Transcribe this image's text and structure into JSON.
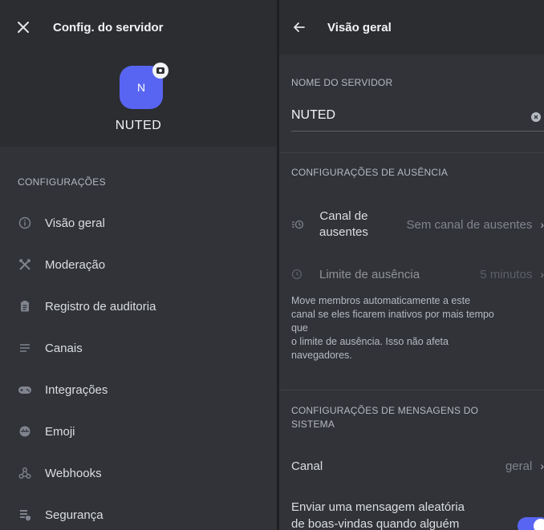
{
  "left": {
    "title": "Config. do servidor",
    "server_initial": "N",
    "server_name": "NUTED",
    "section_label": "CONFIGURAÇÕES",
    "menu": [
      {
        "label": "Visão geral",
        "icon": "info-icon"
      },
      {
        "label": "Moderação",
        "icon": "swords-icon"
      },
      {
        "label": "Registro de auditoria",
        "icon": "clipboard-icon"
      },
      {
        "label": "Canais",
        "icon": "list-icon"
      },
      {
        "label": "Integrações",
        "icon": "gamepad-icon"
      },
      {
        "label": "Emoji",
        "icon": "emoji-icon"
      },
      {
        "label": "Webhooks",
        "icon": "webhook-icon"
      },
      {
        "label": "Segurança",
        "icon": "shield-icon"
      }
    ]
  },
  "right": {
    "title": "Visão geral",
    "server_name_label": "NOME DO SERVIDOR",
    "server_name_value": "NUTED",
    "afk_section_label": "CONFIGURAÇÕES DE AUSÊNCIA",
    "afk_channel_label_1": "Canal de",
    "afk_channel_label_2": "ausentes",
    "afk_channel_value": "Sem canal de ausentes",
    "afk_timeout_label": "Limite de ausência",
    "afk_timeout_value": "5 minutos",
    "afk_description": [
      "Move membros automaticamente a este",
      "canal se eles ficarem inativos por mais tempo",
      "que",
      "o limite de ausência. Isso não afeta",
      "navegadores."
    ],
    "system_section_label_1": "CONFIGURAÇÕES DE MENSAGENS DO",
    "system_section_label_2": "SISTEMA",
    "channel_label": "Canal",
    "channel_value": "geral",
    "welcome_label_1": "Enviar uma mensagem aleatória",
    "welcome_label_2": "de boas-vindas quando alguém",
    "welcome_toggle_on": true
  },
  "colors": {
    "background": "#313338",
    "header": "#2b2d31",
    "accent": "#5865f2",
    "text": "#dbdee1",
    "muted": "#b5bac1"
  }
}
